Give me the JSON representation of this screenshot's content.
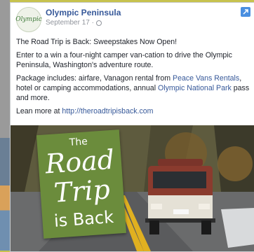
{
  "post": {
    "page_name": "Olympic Peninsula",
    "logo_text": "Olympic",
    "date": "September 17 ·",
    "paragraphs": [
      "The Road Trip is Back: Sweepstakes Now Open!",
      "Enter to a win a four-night camper van-cation to drive the Olympic Peninsula, Washington's adventure route."
    ],
    "package": {
      "t1": "Package includes: airfare, Vanagon rental from ",
      "link1": "Peace Vans Rentals",
      "t2": ", hotel or camping accommodations, annual ",
      "link2": "Olympic National Park",
      "t3": " pass and more."
    },
    "learn_more": {
      "prefix": "Lean more at ",
      "url": "http://theroadtripisback.com"
    }
  },
  "image": {
    "badge": {
      "the": "The",
      "road": "Road",
      "trip": "Trip",
      "is_back": "is Back"
    }
  },
  "icons": {
    "globe": "globe-icon",
    "expand": "expand-icon"
  },
  "colors": {
    "page_bg": "#c7c24e",
    "link": "#365899",
    "badge": "#6b8c3c",
    "van_body": "#8a3b2e"
  }
}
